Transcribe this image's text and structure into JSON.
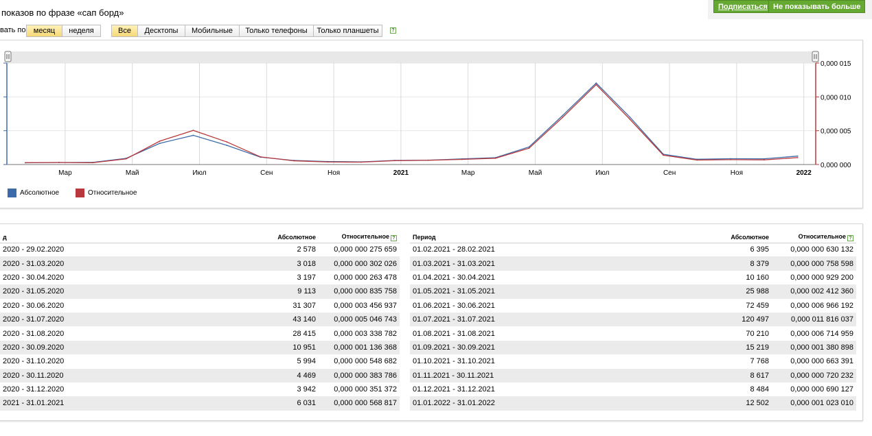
{
  "page": {
    "title": "показов по фразе «сап борд»",
    "subscribe_label": "Подписаться",
    "hide_label": "Не показывать больше",
    "group_label": "вать по:",
    "period_buttons": [
      "месяц",
      "неделя"
    ],
    "device_buttons": [
      "Все",
      "Десктопы",
      "Мобильные",
      "Только телефоны",
      "Только планшеты"
    ],
    "help_glyph": "?"
  },
  "colors": {
    "absolute": "#3d6aa8",
    "relative": "#b8383b",
    "accent_green": "#65a832"
  },
  "chart_data": {
    "type": "line",
    "x": [
      "2020-02",
      "2020-03",
      "2020-04",
      "2020-05",
      "2020-06",
      "2020-07",
      "2020-08",
      "2020-09",
      "2020-10",
      "2020-11",
      "2020-12",
      "2021-01",
      "2021-02",
      "2021-03",
      "2021-04",
      "2021-05",
      "2021-06",
      "2021-07",
      "2021-08",
      "2021-09",
      "2021-10",
      "2021-11",
      "2021-12",
      "2022-01"
    ],
    "x_tick_labels": [
      "Мар",
      "Май",
      "Июл",
      "Сен",
      "Ноя",
      "2021",
      "Мар",
      "Май",
      "Июл",
      "Сен",
      "Ноя",
      "2022"
    ],
    "series": [
      {
        "name": "Абсолютное",
        "axis": "left",
        "values": [
          2578,
          3018,
          3197,
          9113,
          31307,
          43140,
          28415,
          10951,
          5994,
          4469,
          3942,
          6031,
          6395,
          8379,
          10160,
          25988,
          72459,
          120497,
          70210,
          15219,
          7768,
          8617,
          8484,
          12502
        ]
      },
      {
        "name": "Относительное",
        "axis": "right",
        "values": [
          2.75659e-07,
          3.02026e-07,
          2.63478e-07,
          8.35758e-07,
          3.456937e-06,
          5.046743e-06,
          3.338782e-06,
          1.136368e-06,
          5.48682e-07,
          3.83786e-07,
          3.51372e-07,
          5.68817e-07,
          6.30132e-07,
          7.58598e-07,
          9.292e-07,
          2.41236e-06,
          6.966192e-06,
          1.1816037e-05,
          6.714959e-06,
          1.380898e-06,
          6.63391e-07,
          7.20232e-07,
          6.90127e-07,
          1.02301e-06
        ]
      }
    ],
    "y2_tick_labels": [
      "0,000 015",
      "0,000 010",
      "0,000 005",
      "0,000 000"
    ],
    "y2lim": [
      0,
      1.5e-05
    ],
    "ylim": [
      0,
      150000
    ],
    "grid": true,
    "legend": "bottom-left"
  },
  "table": {
    "headers_left": [
      "д",
      "Абсолютное",
      "Относительное"
    ],
    "headers_right": [
      "Период",
      "Абсолютное",
      "Относительное"
    ],
    "rows_left": [
      [
        "2020 - 29.02.2020",
        "2 578",
        "0,000 000 275 659"
      ],
      [
        "2020 - 31.03.2020",
        "3 018",
        "0,000 000 302 026"
      ],
      [
        "2020 - 30.04.2020",
        "3 197",
        "0,000 000 263 478"
      ],
      [
        "2020 - 31.05.2020",
        "9 113",
        "0,000 000 835 758"
      ],
      [
        "2020 - 30.06.2020",
        "31 307",
        "0,000 003 456 937"
      ],
      [
        "2020 - 31.07.2020",
        "43 140",
        "0,000 005 046 743"
      ],
      [
        "2020 - 31.08.2020",
        "28 415",
        "0,000 003 338 782"
      ],
      [
        "2020 - 30.09.2020",
        "10 951",
        "0,000 001 136 368"
      ],
      [
        "2020 - 31.10.2020",
        "5 994",
        "0,000 000 548 682"
      ],
      [
        "2020 - 30.11.2020",
        "4 469",
        "0,000 000 383 786"
      ],
      [
        "2020 - 31.12.2020",
        "3 942",
        "0,000 000 351 372"
      ],
      [
        "2021 - 31.01.2021",
        "6 031",
        "0,000 000 568 817"
      ]
    ],
    "rows_right": [
      [
        "01.02.2021 - 28.02.2021",
        "6 395",
        "0,000 000 630 132"
      ],
      [
        "01.03.2021 - 31.03.2021",
        "8 379",
        "0,000 000 758 598"
      ],
      [
        "01.04.2021 - 30.04.2021",
        "10 160",
        "0,000 000 929 200"
      ],
      [
        "01.05.2021 - 31.05.2021",
        "25 988",
        "0,000 002 412 360"
      ],
      [
        "01.06.2021 - 30.06.2021",
        "72 459",
        "0,000 006 966 192"
      ],
      [
        "01.07.2021 - 31.07.2021",
        "120 497",
        "0,000 011 816 037"
      ],
      [
        "01.08.2021 - 31.08.2021",
        "70 210",
        "0,000 006 714 959"
      ],
      [
        "01.09.2021 - 30.09.2021",
        "15 219",
        "0,000 001 380 898"
      ],
      [
        "01.10.2021 - 31.10.2021",
        "7 768",
        "0,000 000 663 391"
      ],
      [
        "01.11.2021 - 30.11.2021",
        "8 617",
        "0,000 000 720 232"
      ],
      [
        "01.12.2021 - 31.12.2021",
        "8 484",
        "0,000 000 690 127"
      ],
      [
        "01.01.2022 - 31.01.2022",
        "12 502",
        "0,000 001 023 010"
      ]
    ]
  }
}
